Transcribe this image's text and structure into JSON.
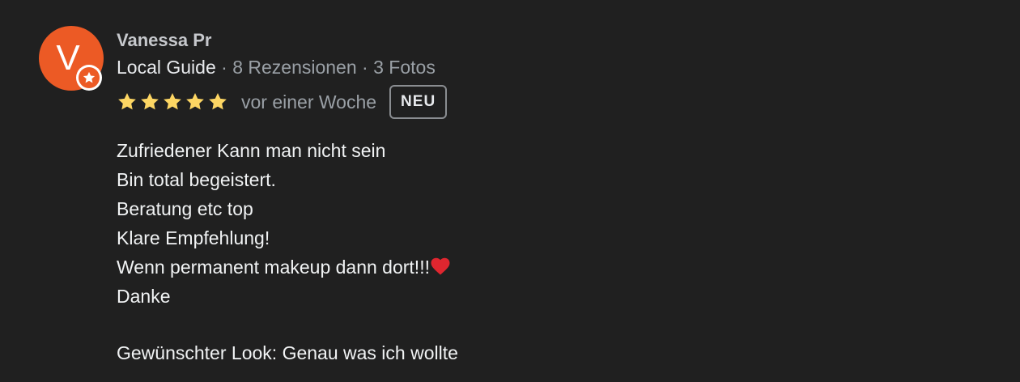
{
  "reviewer": {
    "initial": "V",
    "name": "Vanessa Pr",
    "local_guide_label": "Local Guide",
    "separator": "·",
    "reviews": "8 Rezensionen",
    "photos": "3 Fotos"
  },
  "rating": {
    "stars": 5,
    "max_stars": 5,
    "date": "vor einer Woche",
    "badge": "NEU"
  },
  "review_lines": [
    "Zufriedener Kann man nicht sein",
    "Bin total begeistert.",
    "Beratung etc top",
    "Klare Empfehlung!",
    "Wenn permanent makeup dann dort!!!",
    "Danke"
  ],
  "extra": {
    "label": "Gewünschter Look:",
    "value": "Genau was ich wollte"
  },
  "colors": {
    "background": "#202020",
    "avatar": "#ec5a25",
    "star": "#fdd663",
    "heart": "#e0262f"
  }
}
